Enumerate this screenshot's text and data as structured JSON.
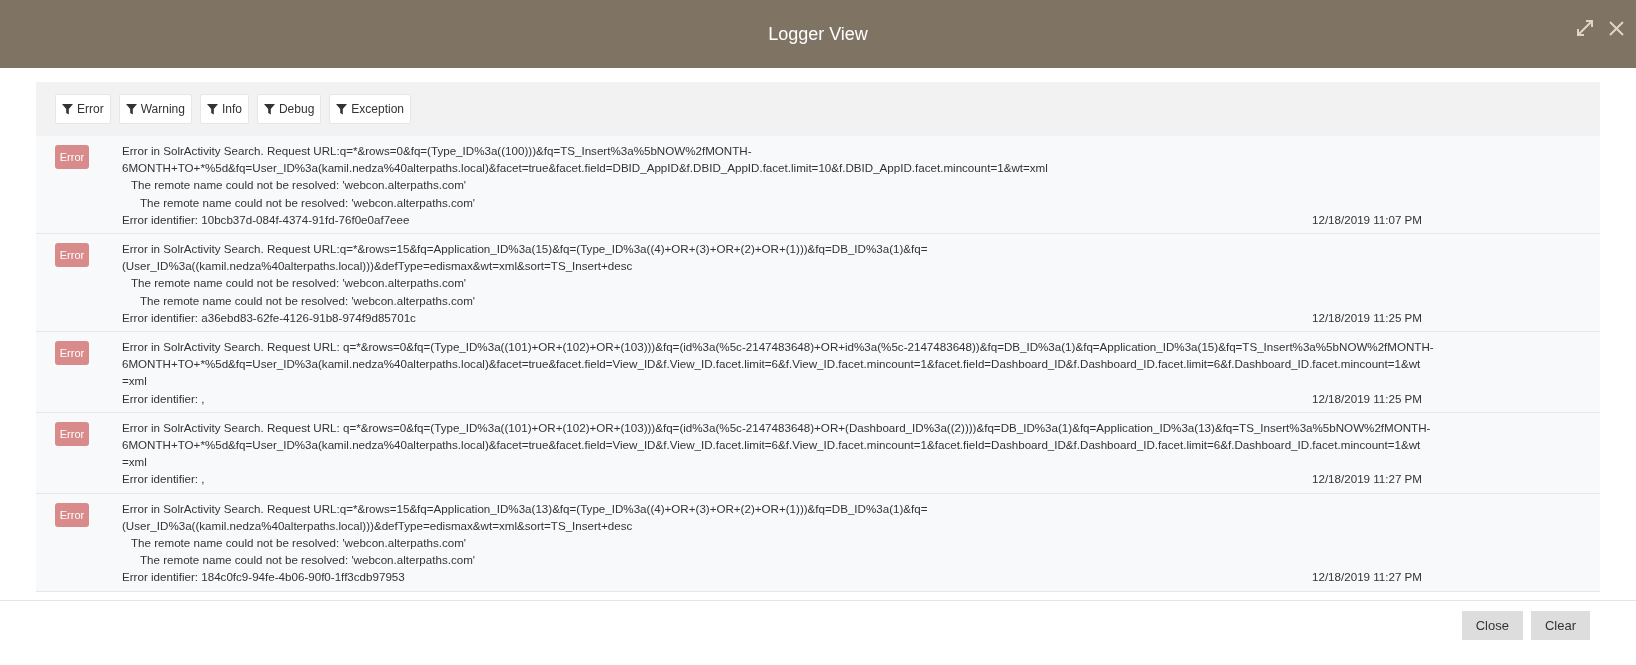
{
  "window": {
    "title": "Logger View"
  },
  "filters": [
    {
      "label": "Error"
    },
    {
      "label": "Warning"
    },
    {
      "label": "Info"
    },
    {
      "label": "Debug"
    },
    {
      "label": "Exception"
    }
  ],
  "entries": [
    {
      "level": "Error",
      "lines": [
        "Error in SolrActivity Search. Request URL:q=*&rows=0&fq=(Type_ID%3a((100)))&fq=TS_Insert%3a%5bNOW%2fMONTH-",
        "6MONTH+TO+*%5d&fq=User_ID%3a(kamil.nedza%40alterpaths.local)&facet=true&facet.field=DBID_AppID&f.DBID_AppID.facet.limit=10&f.DBID_AppID.facet.mincount=1&wt=xml"
      ],
      "details": [
        {
          "text": "The remote name could not be resolved: 'webcon.alterpaths.com'",
          "children": [
            {
              "text": "The remote name could not be resolved: 'webcon.alterpaths.com'"
            }
          ]
        }
      ],
      "identifier": "Error identifier: 10bcb37d-084f-4374-91fd-76f0e0af7eee",
      "date": "12/18/2019 11:07 PM"
    },
    {
      "level": "Error",
      "lines": [
        "Error in SolrActivity Search. Request URL:q=*&rows=15&fq=Application_ID%3a(15)&fq=(Type_ID%3a((4)+OR+(3)+OR+(2)+OR+(1)))&fq=DB_ID%3a(1)&fq=",
        "(User_ID%3a((kamil.nedza%40alterpaths.local)))&defType=edismax&wt=xml&sort=TS_Insert+desc"
      ],
      "details": [
        {
          "text": "The remote name could not be resolved: 'webcon.alterpaths.com'",
          "children": [
            {
              "text": "The remote name could not be resolved: 'webcon.alterpaths.com'"
            }
          ]
        }
      ],
      "identifier": "Error identifier: a36ebd83-62fe-4126-91b8-974f9d85701c",
      "date": "12/18/2019 11:25 PM"
    },
    {
      "level": "Error",
      "lines": [
        "Error in SolrActivity Search. Request URL: q=*&rows=0&fq=(Type_ID%3a((101)+OR+(102)+OR+(103)))&fq=(id%3a(%5c-2147483648)+OR+id%3a(%5c-2147483648))&fq=DB_ID%3a(1)&fq=Application_ID%3a(15)&fq=TS_Insert%3a%5bNOW%2fMONTH-",
        "6MONTH+TO+*%5d&fq=User_ID%3a(kamil.nedza%40alterpaths.local)&facet=true&facet.field=View_ID&f.View_ID.facet.limit=6&f.View_ID.facet.mincount=1&facet.field=Dashboard_ID&f.Dashboard_ID.facet.limit=6&f.Dashboard_ID.facet.mincount=1&wt",
        "=xml"
      ],
      "identifier": "Error identifier: ,",
      "date": "12/18/2019 11:25 PM"
    },
    {
      "level": "Error",
      "lines": [
        "Error in SolrActivity Search. Request URL: q=*&rows=0&fq=(Type_ID%3a((101)+OR+(102)+OR+(103)))&fq=(id%3a(%5c-2147483648)+OR+(Dashboard_ID%3a((2))))&fq=DB_ID%3a(1)&fq=Application_ID%3a(13)&fq=TS_Insert%3a%5bNOW%2fMONTH-",
        "6MONTH+TO+*%5d&fq=User_ID%3a(kamil.nedza%40alterpaths.local)&facet=true&facet.field=View_ID&f.View_ID.facet.limit=6&f.View_ID.facet.mincount=1&facet.field=Dashboard_ID&f.Dashboard_ID.facet.limit=6&f.Dashboard_ID.facet.mincount=1&wt",
        "=xml"
      ],
      "identifier": "Error identifier: ,",
      "date": "12/18/2019 11:27 PM"
    },
    {
      "level": "Error",
      "lines": [
        "Error in SolrActivity Search. Request URL:q=*&rows=15&fq=Application_ID%3a(13)&fq=(Type_ID%3a((4)+OR+(3)+OR+(2)+OR+(1)))&fq=DB_ID%3a(1)&fq=",
        "(User_ID%3a((kamil.nedza%40alterpaths.local)))&defType=edismax&wt=xml&sort=TS_Insert+desc"
      ],
      "details": [
        {
          "text": "The remote name could not be resolved: 'webcon.alterpaths.com'",
          "children": [
            {
              "text": "The remote name could not be resolved: 'webcon.alterpaths.com'"
            }
          ]
        }
      ],
      "identifier": "Error identifier: 184c0fc9-94fe-4b06-90f0-1ff3cdb97953",
      "date": "12/18/2019 11:27 PM"
    }
  ],
  "footer_buttons": [
    {
      "label": "Close"
    },
    {
      "label": "Clear"
    }
  ]
}
